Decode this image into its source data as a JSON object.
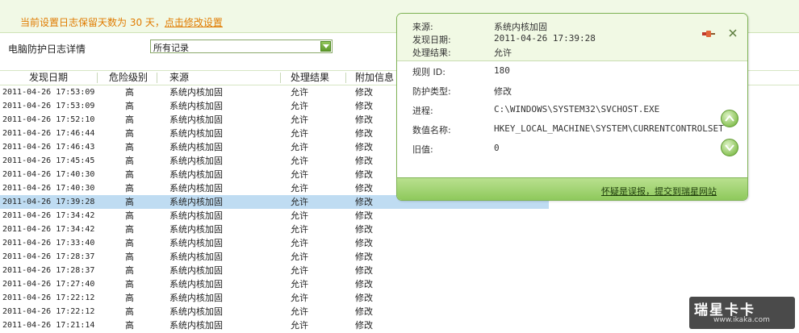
{
  "notice": {
    "text": "当前设置日志保留天数为 30 天，",
    "link": "点击修改设置"
  },
  "filter": {
    "label": "电脑防护日志详情",
    "selected": "所有记录"
  },
  "table": {
    "headers": [
      "发现日期",
      "危险级别",
      "来源",
      "处理结果",
      "附加信息"
    ],
    "rows": [
      [
        "2011-04-26 17:53:09",
        "高",
        "系统内核加固",
        "允许",
        "修改"
      ],
      [
        "2011-04-26 17:53:09",
        "高",
        "系统内核加固",
        "允许",
        "修改"
      ],
      [
        "2011-04-26 17:52:10",
        "高",
        "系统内核加固",
        "允许",
        "修改"
      ],
      [
        "2011-04-26 17:46:44",
        "高",
        "系统内核加固",
        "允许",
        "修改"
      ],
      [
        "2011-04-26 17:46:43",
        "高",
        "系统内核加固",
        "允许",
        "修改"
      ],
      [
        "2011-04-26 17:45:45",
        "高",
        "系统内核加固",
        "允许",
        "修改"
      ],
      [
        "2011-04-26 17:40:30",
        "高",
        "系统内核加固",
        "允许",
        "修改"
      ],
      [
        "2011-04-26 17:40:30",
        "高",
        "系统内核加固",
        "允许",
        "修改"
      ],
      [
        "2011-04-26 17:39:28",
        "高",
        "系统内核加固",
        "允许",
        "修改"
      ],
      [
        "2011-04-26 17:34:42",
        "高",
        "系统内核加固",
        "允许",
        "修改"
      ],
      [
        "2011-04-26 17:34:42",
        "高",
        "系统内核加固",
        "允许",
        "修改"
      ],
      [
        "2011-04-26 17:33:40",
        "高",
        "系统内核加固",
        "允许",
        "修改"
      ],
      [
        "2011-04-26 17:28:37",
        "高",
        "系统内核加固",
        "允许",
        "修改"
      ],
      [
        "2011-04-26 17:28:37",
        "高",
        "系统内核加固",
        "允许",
        "修改"
      ],
      [
        "2011-04-26 17:27:40",
        "高",
        "系统内核加固",
        "允许",
        "修改"
      ],
      [
        "2011-04-26 17:22:12",
        "高",
        "系统内核加固",
        "允许",
        "修改"
      ],
      [
        "2011-04-26 17:22:12",
        "高",
        "系统内核加固",
        "允许",
        "修改"
      ],
      [
        "2011-04-26 17:21:14",
        "高",
        "系统内核加固",
        "允许",
        "修改"
      ]
    ],
    "selected_index": 8
  },
  "popup": {
    "source_label": "来源:",
    "source_value": "系统内核加固",
    "date_label": "发现日期:",
    "date_value": "2011-04-26 17:39:28",
    "result_label": "处理结果:",
    "result_value": "允许",
    "rule_label": "规则 ID:",
    "rule_value": "180",
    "type_label": "防护类型:",
    "type_value": "修改",
    "process_label": "进程:",
    "process_value": "C:\\WINDOWS\\SYSTEM32\\SVCHOST.EXE",
    "value_name_label": "数值名称:",
    "value_name_value": "HKEY_LOCAL_MACHINE\\SYSTEM\\CURRENTCONTROLSET",
    "old_value_label": "旧值:",
    "old_value_value": "0",
    "report_link": "怀疑是误报，提交到瑞星网站"
  },
  "watermark": {
    "brand": "瑞星卡卡",
    "url": "www.ikaka.com"
  },
  "colors": {
    "accent_green": "#7fb356",
    "notice_orange": "#e07b00",
    "selected_row": "#bfdcf2"
  },
  "icons": [
    "pin-icon",
    "close-icon",
    "scroll-up-icon",
    "scroll-down-icon",
    "chevron-down-icon"
  ]
}
